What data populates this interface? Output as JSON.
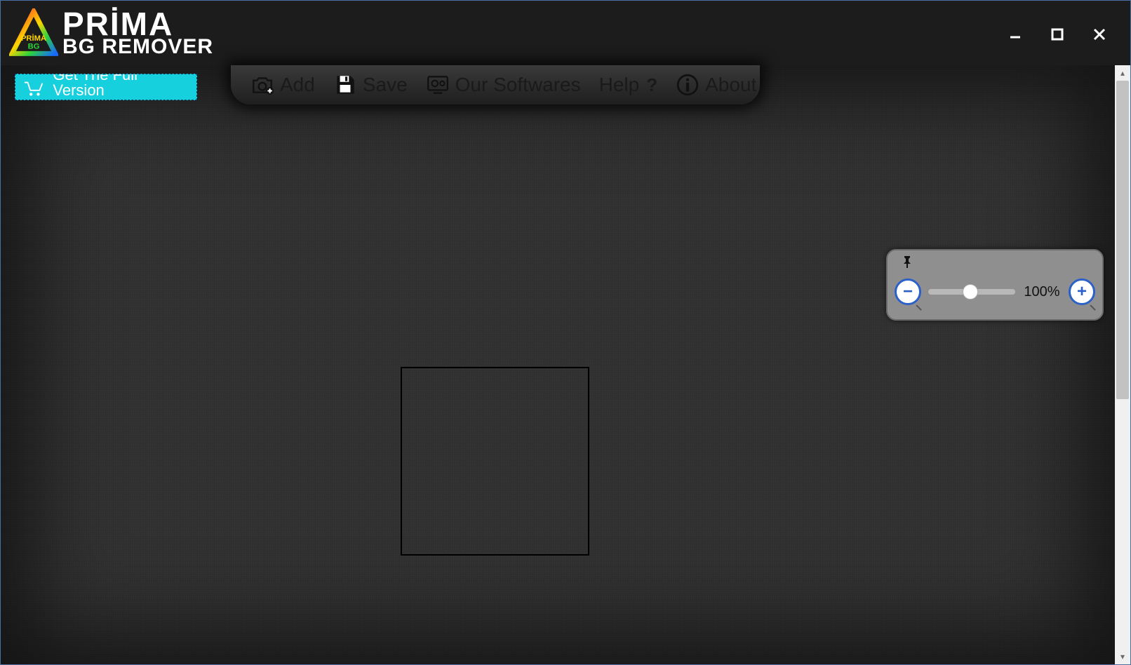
{
  "app": {
    "logo_line1": "PRİMA",
    "logo_line2": "BG REMOVER",
    "logo_badge_line1": "PRİMA",
    "logo_badge_line2": "BG"
  },
  "promo": {
    "label": "Get The Full Version"
  },
  "toolbar": {
    "add": "Add",
    "save": "Save",
    "our_softwares": "Our Softwares",
    "help": "Help",
    "help_mark": "?",
    "about": "About"
  },
  "zoom": {
    "value_label": "100%",
    "value": 100,
    "min": 0,
    "max": 200
  },
  "colors": {
    "accent": "#16d0de",
    "panel": "#8f8f8f"
  }
}
